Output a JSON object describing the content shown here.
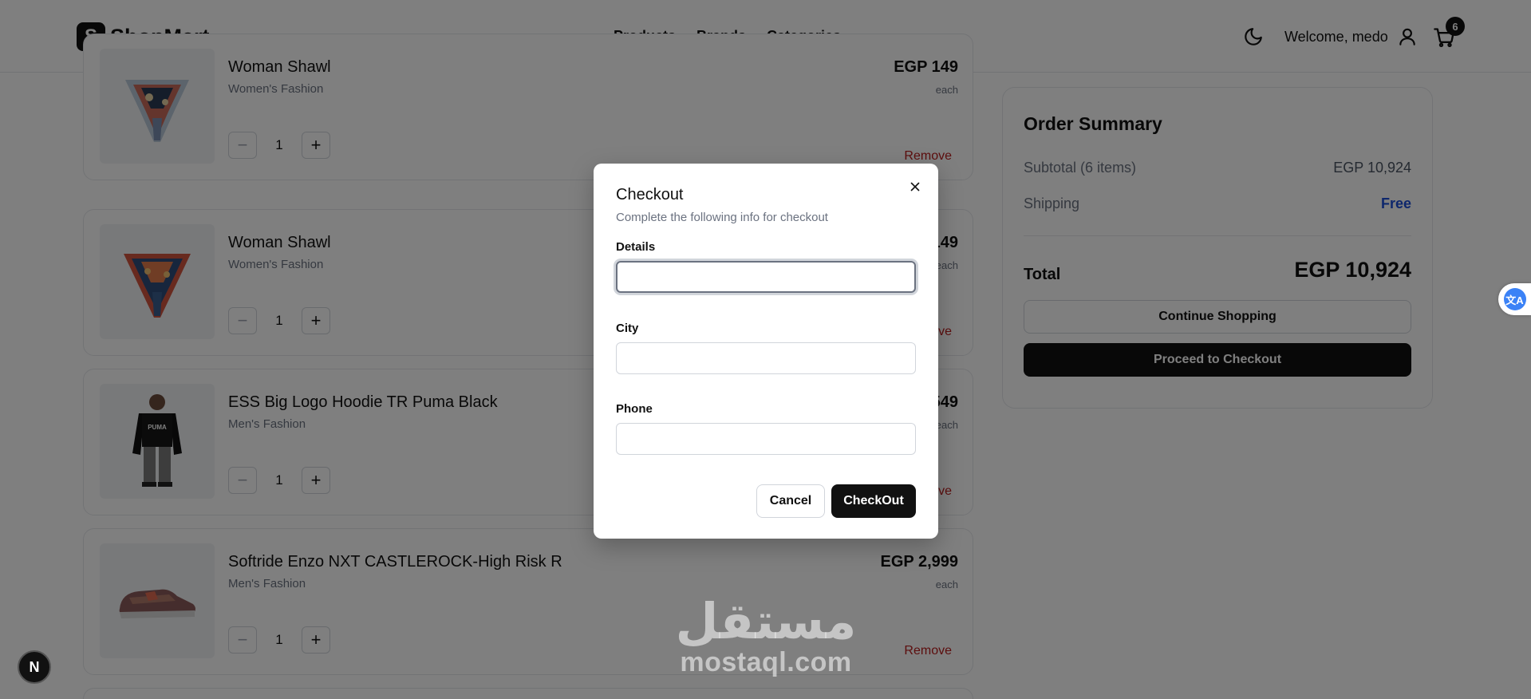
{
  "header": {
    "logo_letter": "S",
    "logo_text": "ShopMart",
    "nav": [
      "Products",
      "Brands",
      "Categories"
    ],
    "welcome": "Welcome, medo",
    "cart_count": "6"
  },
  "cart": {
    "items": [
      {
        "name": "Woman Shawl",
        "category": "Women's Fashion",
        "quantity": "1",
        "price": "EGP 149",
        "price_unit": "each",
        "remove_label": "Remove"
      },
      {
        "name": "Woman Shawl",
        "category": "Women's Fashion",
        "quantity": "1",
        "price": "EGP 149",
        "price_unit": "each",
        "remove_label": "Remove"
      },
      {
        "name": "ESS Big Logo Hoodie TR Puma Black",
        "category": "Men's Fashion",
        "quantity": "1",
        "price": "EGP 2,549",
        "price_unit": "each",
        "remove_label": "Remove"
      },
      {
        "name": "Softride Enzo NXT CASTLEROCK-High Risk R",
        "category": "Men's Fashion",
        "quantity": "1",
        "price": "EGP 2,999",
        "price_unit": "each",
        "remove_label": "Remove"
      }
    ]
  },
  "summary": {
    "title": "Order Summary",
    "subtotal_label": "Subtotal (6 items)",
    "subtotal_value": "EGP 10,924",
    "shipping_label": "Shipping",
    "shipping_value": "Free",
    "total_label": "Total",
    "total_value": "EGP 10,924",
    "continue_label": "Continue Shopping",
    "proceed_label": "Proceed to Checkout"
  },
  "modal": {
    "title": "Checkout",
    "description": "Complete the following info for checkout",
    "fields": [
      {
        "label": "Details",
        "value": ""
      },
      {
        "label": "City",
        "value": ""
      },
      {
        "label": "Phone",
        "value": ""
      }
    ],
    "cancel_label": "Cancel",
    "checkout_label": "CheckOut"
  },
  "floating": {
    "next_badge": "N",
    "translate_label": "文A"
  },
  "watermark": {
    "arabic": "مستقل",
    "latin": "mostaql.com"
  }
}
